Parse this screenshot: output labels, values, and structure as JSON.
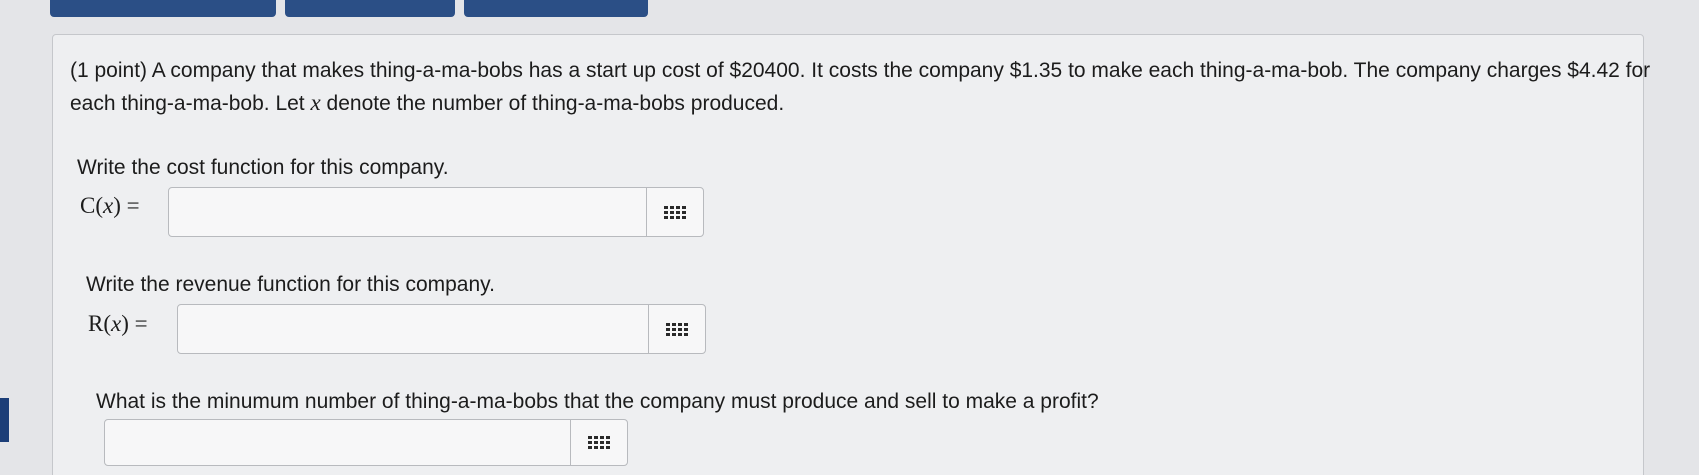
{
  "problem": {
    "points": "(1 point)",
    "text_part1": "A company that makes thing-a-ma-bobs has a start up cost of $20400. It costs the company $1.35 to make each thing-a-ma-bob. The company charges $4.42 for each thing-a-ma-bob. Let",
    "variable": "x",
    "text_part2": "denote the number of thing-a-ma-bobs produced."
  },
  "questions": [
    {
      "prompt": "Write the cost function for this company.",
      "function_name": "C",
      "function_arg": "x",
      "equals": "=",
      "value": ""
    },
    {
      "prompt": "Write the revenue function for this company.",
      "function_name": "R",
      "function_arg": "x",
      "equals": "=",
      "value": ""
    },
    {
      "prompt": "What is the minumum number of thing-a-ma-bobs that the company must produce and sell to make a profit?",
      "value": ""
    }
  ],
  "icons": {
    "equation_palette": "math-palette-icon"
  },
  "colors": {
    "tab_blue": "#2b4f86",
    "background": "#e4e5e8",
    "panel": "#eeeff1"
  }
}
